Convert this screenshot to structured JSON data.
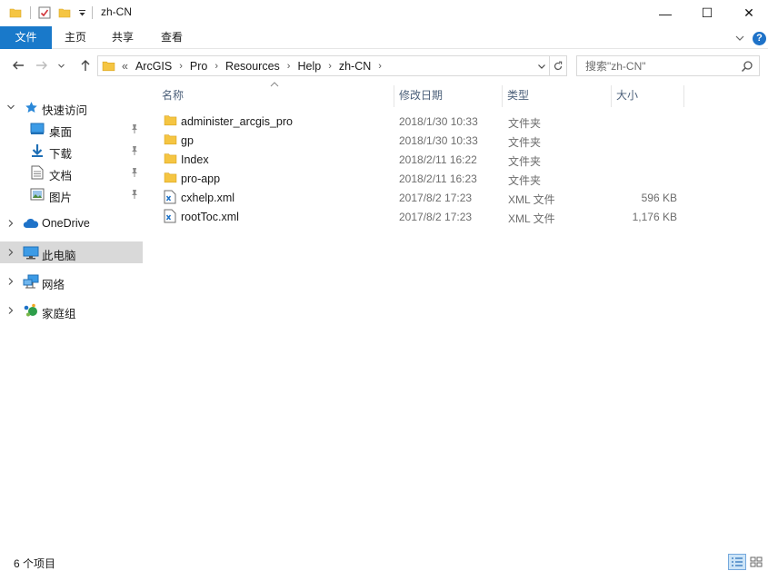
{
  "window": {
    "title": "zh-CN",
    "minimize_glyph": "—",
    "maximize_glyph": "☐",
    "close_glyph": "✕"
  },
  "ribbon": {
    "tabs": [
      {
        "label": "文件"
      },
      {
        "label": "主页"
      },
      {
        "label": "共享"
      },
      {
        "label": "查看"
      }
    ],
    "help_glyph": "?"
  },
  "address": {
    "overflow": "«",
    "breadcrumbs": [
      "ArcGIS",
      "Pro",
      "Resources",
      "Help",
      "zh-CN"
    ],
    "separator": "›"
  },
  "search": {
    "placeholder": "搜索\"zh-CN\""
  },
  "nav": {
    "quick_access": "快速访问",
    "pinned": [
      {
        "label": "桌面",
        "icon": "desktop-icon"
      },
      {
        "label": "下载",
        "icon": "download-icon"
      },
      {
        "label": "文档",
        "icon": "document-icon"
      },
      {
        "label": "图片",
        "icon": "pictures-icon"
      }
    ],
    "onedrive": "OneDrive",
    "this_pc": "此电脑",
    "network": "网络",
    "homegroup": "家庭组"
  },
  "columns": {
    "name": "名称",
    "date": "修改日期",
    "type": "类型",
    "size": "大小"
  },
  "files": [
    {
      "name": "administer_arcgis_pro",
      "date": "2018/1/30 10:33",
      "type": "文件夹",
      "size": "",
      "icon": "folder-icon"
    },
    {
      "name": "gp",
      "date": "2018/1/30 10:33",
      "type": "文件夹",
      "size": "",
      "icon": "folder-icon"
    },
    {
      "name": "Index",
      "date": "2018/2/11 16:22",
      "type": "文件夹",
      "size": "",
      "icon": "folder-icon"
    },
    {
      "name": "pro-app",
      "date": "2018/2/11 16:23",
      "type": "文件夹",
      "size": "",
      "icon": "folder-icon"
    },
    {
      "name": "cxhelp.xml",
      "date": "2017/8/2 17:23",
      "type": "XML 文件",
      "size": "596 KB",
      "icon": "xml-file-icon"
    },
    {
      "name": "rootToc.xml",
      "date": "2017/8/2 17:23",
      "type": "XML 文件",
      "size": "1,176 KB",
      "icon": "xml-file-icon"
    }
  ],
  "status": {
    "item_count": "6 个项目"
  },
  "colors": {
    "accent": "#1979ca",
    "folder": "#f5c542",
    "selected_nav": "#d9d9d9"
  }
}
